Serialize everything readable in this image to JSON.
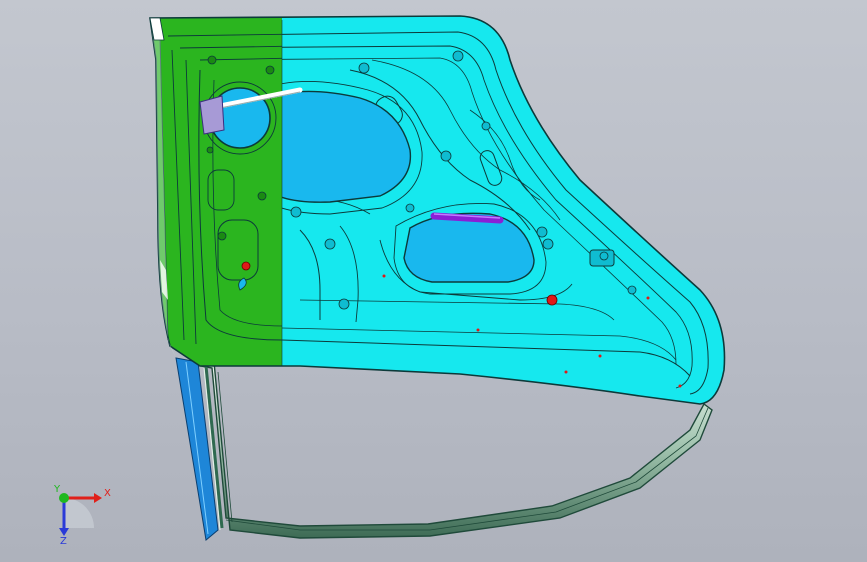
{
  "viewport": {
    "colors": {
      "background": "#bcc0c9",
      "panel_cyan": "#16e8ee",
      "panel_cyan_dark": "#0fbcd1",
      "cutout_blue": "#19b8ee",
      "panel_green": "#2bb51f",
      "panel_green_dark": "#1a8a12",
      "edge_dark": "#0c3a3a",
      "rod_purple": "#8a1fd6",
      "seal_light": "#d6ece0",
      "seal_dark": "#1f4a3a",
      "marker_red": "#e01818"
    },
    "model_name": "car-door-inner-panel",
    "triad": {
      "x_label": "X",
      "y_label": "Y",
      "z_label": "Z",
      "x_color": "#e0201a",
      "y_color": "#1fb81f",
      "z_color": "#2a3ad8"
    }
  }
}
